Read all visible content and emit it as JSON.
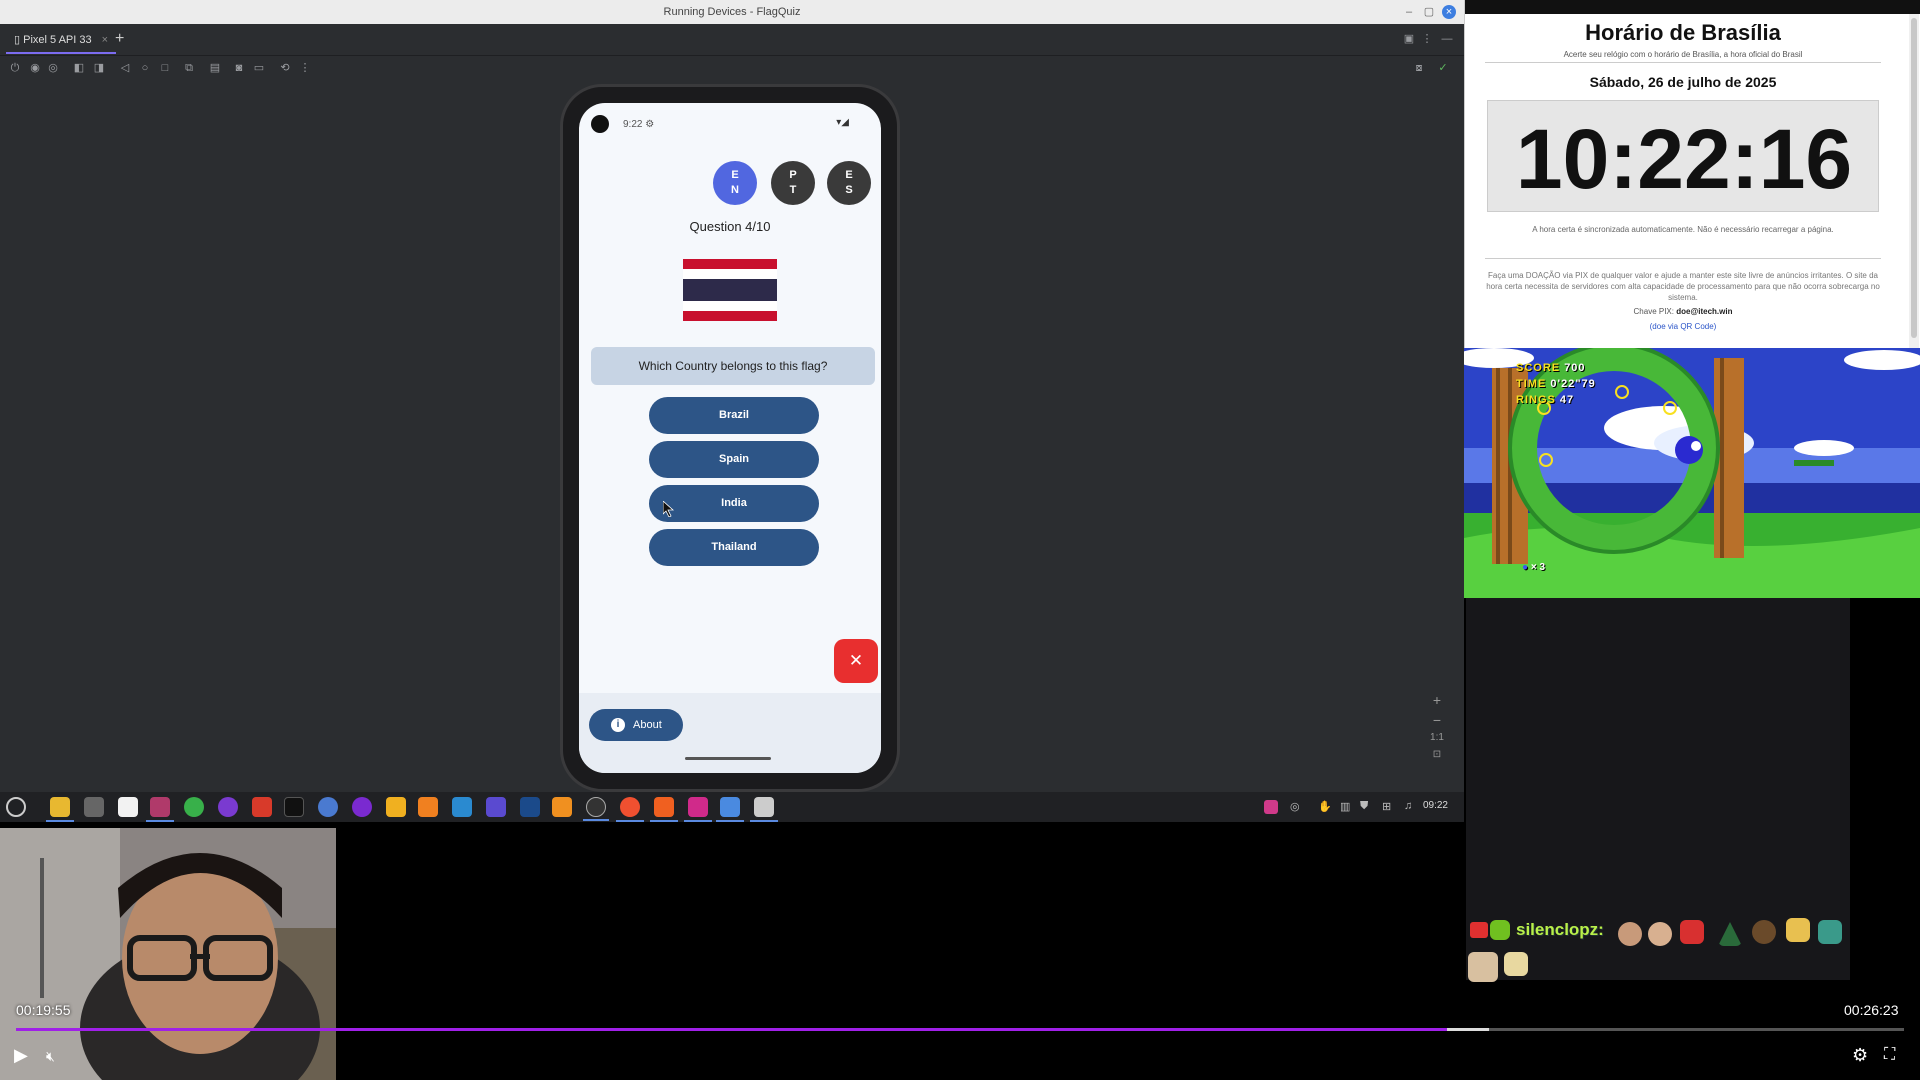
{
  "studio": {
    "window_title": "Running Devices - FlagQuiz",
    "device_tab": "Pixel 5 API 33"
  },
  "phone": {
    "status_time": "9:22",
    "languages": [
      {
        "code": "EN",
        "active": true
      },
      {
        "code": "PT",
        "active": false
      },
      {
        "code": "ES",
        "active": false
      }
    ],
    "question_counter": "Question 4/10",
    "prompt": "Which Country belongs to this flag?",
    "answers": [
      "Brazil",
      "Spain",
      "India",
      "Thailand"
    ],
    "about_label": "About",
    "flag_colors": {
      "red": "#c8102e",
      "white": "#ffffff",
      "blue": "#2d2a4a"
    }
  },
  "taskbar": {
    "clock": "09:22"
  },
  "brasilia": {
    "title": "Horário de Brasília",
    "subtitle": "Acerte seu relógio com o horário de Brasília, a hora oficial do Brasil",
    "date": "Sábado, 26 de julho de 2025",
    "time": "10:22:16",
    "auto_note": "A hora certa é sincronizada automaticamente. Não é necessário recarregar a página.",
    "donate_text": "Faça uma DOAÇÃO via PIX de qualquer valor e ajude a manter este site livre de anúncios irritantes. O site da hora certa necessita de servidores com alta capacidade de processamento para que não ocorra sobrecarga no sistema.",
    "pix_label": "Chave PIX:",
    "pix_key": "doe@itech.win",
    "qr_link": "(doe via QR Code)"
  },
  "game": {
    "score_label": "SCORE",
    "score_value": "700",
    "time_label": "TIME",
    "time_value": "0'22\"79",
    "rings_label": "RINGS",
    "rings_value": "47",
    "lives": "× 3"
  },
  "chat": {
    "username": "silenclopz:"
  },
  "player": {
    "elapsed": "00:19:55",
    "duration": "00:26:23",
    "progress_fraction": 0.758,
    "buffered_fraction": 0.022
  }
}
